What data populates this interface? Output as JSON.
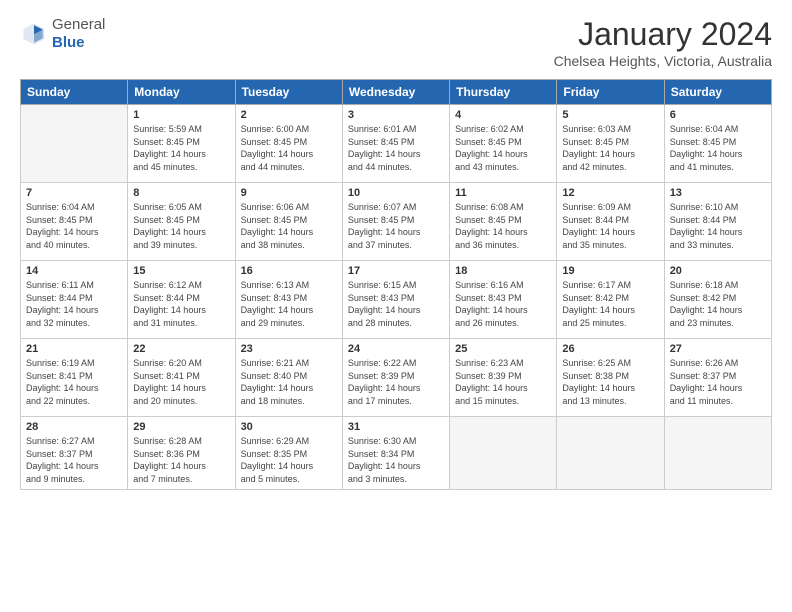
{
  "header": {
    "logo_general": "General",
    "logo_blue": "Blue",
    "title": "January 2024",
    "subtitle": "Chelsea Heights, Victoria, Australia"
  },
  "weekdays": [
    "Sunday",
    "Monday",
    "Tuesday",
    "Wednesday",
    "Thursday",
    "Friday",
    "Saturday"
  ],
  "weeks": [
    [
      {
        "day": "",
        "info": ""
      },
      {
        "day": "1",
        "info": "Sunrise: 5:59 AM\nSunset: 8:45 PM\nDaylight: 14 hours\nand 45 minutes."
      },
      {
        "day": "2",
        "info": "Sunrise: 6:00 AM\nSunset: 8:45 PM\nDaylight: 14 hours\nand 44 minutes."
      },
      {
        "day": "3",
        "info": "Sunrise: 6:01 AM\nSunset: 8:45 PM\nDaylight: 14 hours\nand 44 minutes."
      },
      {
        "day": "4",
        "info": "Sunrise: 6:02 AM\nSunset: 8:45 PM\nDaylight: 14 hours\nand 43 minutes."
      },
      {
        "day": "5",
        "info": "Sunrise: 6:03 AM\nSunset: 8:45 PM\nDaylight: 14 hours\nand 42 minutes."
      },
      {
        "day": "6",
        "info": "Sunrise: 6:04 AM\nSunset: 8:45 PM\nDaylight: 14 hours\nand 41 minutes."
      }
    ],
    [
      {
        "day": "7",
        "info": "Sunrise: 6:04 AM\nSunset: 8:45 PM\nDaylight: 14 hours\nand 40 minutes."
      },
      {
        "day": "8",
        "info": "Sunrise: 6:05 AM\nSunset: 8:45 PM\nDaylight: 14 hours\nand 39 minutes."
      },
      {
        "day": "9",
        "info": "Sunrise: 6:06 AM\nSunset: 8:45 PM\nDaylight: 14 hours\nand 38 minutes."
      },
      {
        "day": "10",
        "info": "Sunrise: 6:07 AM\nSunset: 8:45 PM\nDaylight: 14 hours\nand 37 minutes."
      },
      {
        "day": "11",
        "info": "Sunrise: 6:08 AM\nSunset: 8:45 PM\nDaylight: 14 hours\nand 36 minutes."
      },
      {
        "day": "12",
        "info": "Sunrise: 6:09 AM\nSunset: 8:44 PM\nDaylight: 14 hours\nand 35 minutes."
      },
      {
        "day": "13",
        "info": "Sunrise: 6:10 AM\nSunset: 8:44 PM\nDaylight: 14 hours\nand 33 minutes."
      }
    ],
    [
      {
        "day": "14",
        "info": "Sunrise: 6:11 AM\nSunset: 8:44 PM\nDaylight: 14 hours\nand 32 minutes."
      },
      {
        "day": "15",
        "info": "Sunrise: 6:12 AM\nSunset: 8:44 PM\nDaylight: 14 hours\nand 31 minutes."
      },
      {
        "day": "16",
        "info": "Sunrise: 6:13 AM\nSunset: 8:43 PM\nDaylight: 14 hours\nand 29 minutes."
      },
      {
        "day": "17",
        "info": "Sunrise: 6:15 AM\nSunset: 8:43 PM\nDaylight: 14 hours\nand 28 minutes."
      },
      {
        "day": "18",
        "info": "Sunrise: 6:16 AM\nSunset: 8:43 PM\nDaylight: 14 hours\nand 26 minutes."
      },
      {
        "day": "19",
        "info": "Sunrise: 6:17 AM\nSunset: 8:42 PM\nDaylight: 14 hours\nand 25 minutes."
      },
      {
        "day": "20",
        "info": "Sunrise: 6:18 AM\nSunset: 8:42 PM\nDaylight: 14 hours\nand 23 minutes."
      }
    ],
    [
      {
        "day": "21",
        "info": "Sunrise: 6:19 AM\nSunset: 8:41 PM\nDaylight: 14 hours\nand 22 minutes."
      },
      {
        "day": "22",
        "info": "Sunrise: 6:20 AM\nSunset: 8:41 PM\nDaylight: 14 hours\nand 20 minutes."
      },
      {
        "day": "23",
        "info": "Sunrise: 6:21 AM\nSunset: 8:40 PM\nDaylight: 14 hours\nand 18 minutes."
      },
      {
        "day": "24",
        "info": "Sunrise: 6:22 AM\nSunset: 8:39 PM\nDaylight: 14 hours\nand 17 minutes."
      },
      {
        "day": "25",
        "info": "Sunrise: 6:23 AM\nSunset: 8:39 PM\nDaylight: 14 hours\nand 15 minutes."
      },
      {
        "day": "26",
        "info": "Sunrise: 6:25 AM\nSunset: 8:38 PM\nDaylight: 14 hours\nand 13 minutes."
      },
      {
        "day": "27",
        "info": "Sunrise: 6:26 AM\nSunset: 8:37 PM\nDaylight: 14 hours\nand 11 minutes."
      }
    ],
    [
      {
        "day": "28",
        "info": "Sunrise: 6:27 AM\nSunset: 8:37 PM\nDaylight: 14 hours\nand 9 minutes."
      },
      {
        "day": "29",
        "info": "Sunrise: 6:28 AM\nSunset: 8:36 PM\nDaylight: 14 hours\nand 7 minutes."
      },
      {
        "day": "30",
        "info": "Sunrise: 6:29 AM\nSunset: 8:35 PM\nDaylight: 14 hours\nand 5 minutes."
      },
      {
        "day": "31",
        "info": "Sunrise: 6:30 AM\nSunset: 8:34 PM\nDaylight: 14 hours\nand 3 minutes."
      },
      {
        "day": "",
        "info": ""
      },
      {
        "day": "",
        "info": ""
      },
      {
        "day": "",
        "info": ""
      }
    ]
  ]
}
